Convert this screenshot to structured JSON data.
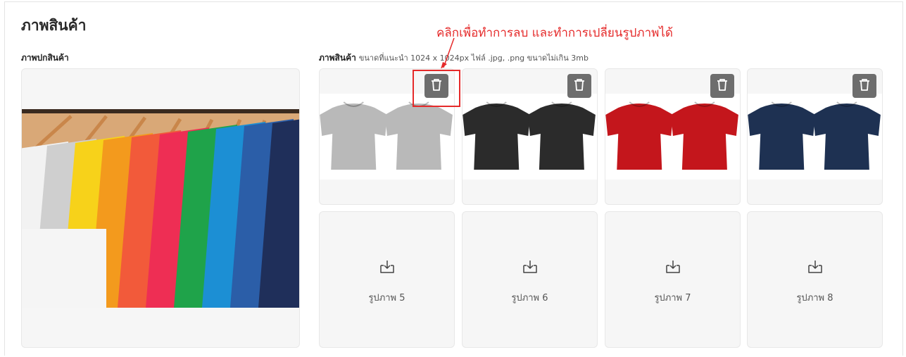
{
  "section": {
    "title": "ภาพสินค้า",
    "cover_label": "ภาพปกสินค้า",
    "images_label": "ภาพสินค้า",
    "images_hint": "ขนาดที่แนะนำ 1024 x 1024px ไฟล์ .jpg, .png ขนาดไม่เกิน 3mb"
  },
  "annotation": {
    "text": "คลิกเพื่อทำการลบ และทำการเปลี่ยนรูปภาพได้",
    "color": "#e52a2a"
  },
  "product_images": [
    {
      "shirt_color": "#b9b9b9",
      "delete_icon": "trash-icon"
    },
    {
      "shirt_color": "#2b2b2b",
      "delete_icon": "trash-icon"
    },
    {
      "shirt_color": "#c4161c",
      "delete_icon": "trash-icon"
    },
    {
      "shirt_color": "#1e3152",
      "delete_icon": "trash-icon"
    }
  ],
  "upload_slots": [
    {
      "label": "รูปภาพ 5",
      "icon": "upload-icon"
    },
    {
      "label": "รูปภาพ 6",
      "icon": "upload-icon"
    },
    {
      "label": "รูปภาพ 7",
      "icon": "upload-icon"
    },
    {
      "label": "รูปภาพ 8",
      "icon": "upload-icon"
    }
  ],
  "colors": {
    "card_bg": "#f6f6f6",
    "delete_button_bg": "#6d6d6d",
    "cover_shirts": [
      "#f2f2f2",
      "#cfcfcf",
      "#f7d21a",
      "#f39a1d",
      "#f25a3a",
      "#ee2e54",
      "#1fa34a",
      "#1c8fd4",
      "#2b5ea8",
      "#1f2f5a"
    ]
  }
}
